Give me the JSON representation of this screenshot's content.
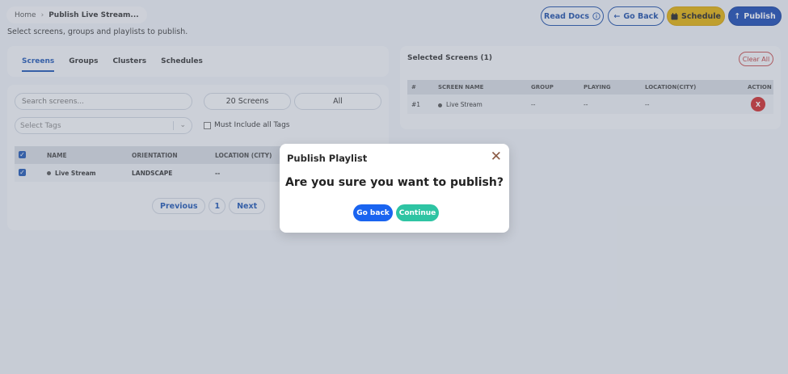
{
  "breadcrumb": {
    "home": "Home",
    "current": "Publish Live Stream..."
  },
  "subtitle": "Select screens, groups and playlists to publish.",
  "toolbar": {
    "read_docs": "Read Docs",
    "go_back": "Go Back",
    "schedule": "Schedule",
    "publish": "Publish"
  },
  "tabs": [
    {
      "label": "Screens",
      "active": true
    },
    {
      "label": "Groups"
    },
    {
      "label": "Clusters"
    },
    {
      "label": "Schedules"
    }
  ],
  "screens_panel": {
    "search_placeholder": "Search screens...",
    "count_label": "20 Screens",
    "all_label": "All",
    "tags_placeholder": "Select Tags",
    "must_include": "Must Include all Tags",
    "columns": [
      "NAME",
      "ORIENTATION",
      "LOCATION (CITY)"
    ],
    "rows": [
      {
        "name": "Live Stream",
        "orientation": "LANDSCAPE",
        "location": "--"
      }
    ],
    "pagination": {
      "previous": "Previous",
      "page": "1",
      "next": "Next"
    }
  },
  "selected_panel": {
    "title": "Selected Screens (1)",
    "clear_all": "Clear All",
    "columns": [
      "#",
      "SCREEN NAME",
      "GROUP",
      "PLAYING",
      "LOCATION(CITY)",
      "ACTION"
    ],
    "rows": [
      {
        "index": "#1",
        "name": "Live Stream",
        "group": "--",
        "playing": "--",
        "location": "--",
        "action": "X"
      }
    ]
  },
  "modal": {
    "title": "Publish Playlist",
    "question": "Are you sure you want to publish?",
    "go_back": "Go back",
    "continue": "Continue"
  },
  "colors": {
    "primary": "#1f56b3",
    "schedule": "#e3b008",
    "danger": "#d02a2a",
    "continue": "#2ec4a3",
    "modal_goback": "#1a64f0"
  }
}
